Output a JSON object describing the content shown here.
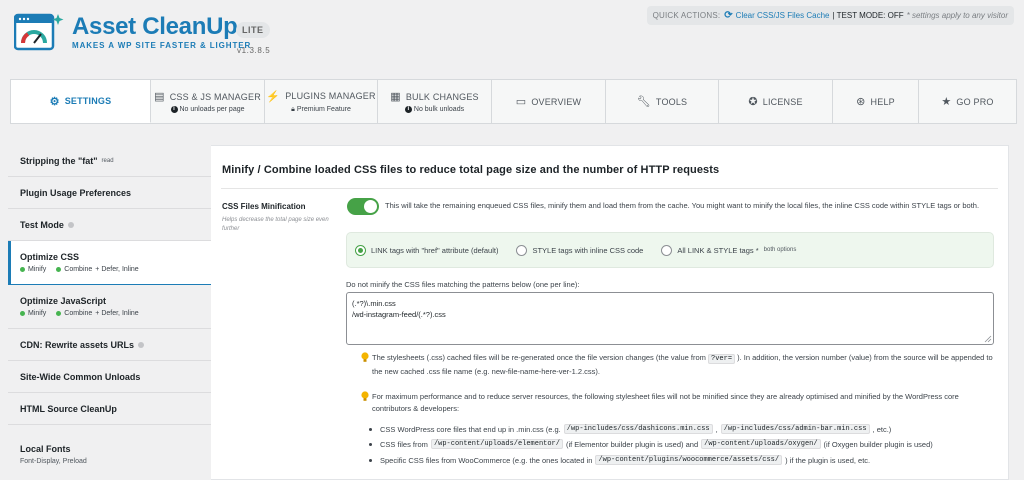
{
  "header": {
    "brand_name": "Asset CleanUp",
    "edition": "LITE",
    "tagline": "MAKES A WP SITE FASTER & LIGHTER",
    "version": "v1.3.8.5"
  },
  "quick_actions": {
    "label": "QUICK ACTIONS:",
    "clear_cache_link": "Clear CSS/JS Files Cache",
    "test_mode": "| TEST MODE: OFF",
    "note": "* settings apply to any visitor"
  },
  "tabs": [
    {
      "label": "SETTINGS",
      "icon": "gear-icon",
      "sub": ""
    },
    {
      "label": "CSS & JS MANAGER",
      "icon": "code-icon",
      "sub": "No unloads per page"
    },
    {
      "label": "PLUGINS MANAGER",
      "icon": "plug-icon",
      "sub": "Premium Feature"
    },
    {
      "label": "BULK CHANGES",
      "icon": "grid-icon",
      "sub": "No bulk unloads"
    },
    {
      "label": "OVERVIEW",
      "icon": "document-icon",
      "sub": ""
    },
    {
      "label": "TOOLS",
      "icon": "wrench-icon",
      "sub": ""
    },
    {
      "label": "LICENSE",
      "icon": "license-icon",
      "sub": ""
    },
    {
      "label": "HELP",
      "icon": "lifebuoy-icon",
      "sub": ""
    },
    {
      "label": "GO PRO",
      "icon": "star-icon",
      "sub": ""
    }
  ],
  "sidebar": {
    "items": [
      {
        "label": "Stripping the \"fat\"",
        "small": "read"
      },
      {
        "label": "Plugin Usage Preferences"
      },
      {
        "label": "Test Mode"
      },
      {
        "label": "Optimize CSS",
        "meta": [
          "Minify",
          "Combine",
          "+ Defer, Inline"
        ]
      },
      {
        "label": "Optimize JavaScript",
        "meta": [
          "Minify",
          "Combine",
          "+ Defer, Inline"
        ]
      },
      {
        "label": "CDN: Rewrite assets URLs"
      },
      {
        "label": "Site-Wide Common Unloads"
      },
      {
        "label": "HTML Source CleanUp"
      },
      {
        "label": "Local Fonts",
        "sub": "Font-Display, Preload"
      }
    ]
  },
  "main": {
    "heading": "Minify / Combine loaded CSS files to reduce total page size and the number of HTTP requests",
    "option_label": "CSS Files Minification",
    "option_desc": "Helps decrease the total page size even further",
    "toggle_text": "This will take the remaining enqueued CSS files, minify them and load them from the cache. You might want to minify the local files, the inline CSS code within STYLE tags or both.",
    "radios": [
      {
        "label": "LINK tags with \"href\" attribute (default)",
        "tiny": ""
      },
      {
        "label": "STYLE tags with inline CSS code",
        "tiny": ""
      },
      {
        "label": "All LINK & STYLE tags *",
        "tiny": "both options"
      }
    ],
    "patterns_label": "Do not minify the CSS files matching the patterns below (one per line):",
    "patterns_value": "(.*?)\\.min.css\n/wd-instagram-feed/(.*?).css",
    "tip1_a": "The stylesheets (.css) cached files will be re-generated once the file version changes (the value from",
    "tip1_code": "?ver=",
    "tip1_b": "). In addition, the version number (value) from the source will be appended to the new cached .css file name (e.g. new-file-name-here-ver-1.2.css).",
    "tip2": "For maximum performance and to reduce server resources, the following stylesheet files will not be minified since they are already optimised and minified by the WordPress core contributors & developers:",
    "bullet1_a": "CSS WordPress core files that end up in .min.css (e.g.",
    "bullet1_code1": "/wp-includes/css/dashicons.min.css",
    "bullet1_sep": ",",
    "bullet1_code2": "/wp-includes/css/admin-bar.min.css",
    "bullet1_b": ", etc.)",
    "bullet2_a": "CSS files from",
    "bullet2_code1": "/wp-content/uploads/elementor/",
    "bullet2_b": "(if Elementor builder plugin is used) and",
    "bullet2_code2": "/wp-content/uploads/oxygen/",
    "bullet2_c": "(if Oxygen builder plugin is used)",
    "bullet3_a": "Specific CSS files from WooCommerce (e.g. the ones located in",
    "bullet3_code": "/wp-content/plugins/woocommerce/assets/css/",
    "bullet3_b": ") if the plugin is used, etc."
  },
  "colors": {
    "brand": "#1c7cb6",
    "toggle_on": "#46a247",
    "bulb": "#f4b400"
  }
}
